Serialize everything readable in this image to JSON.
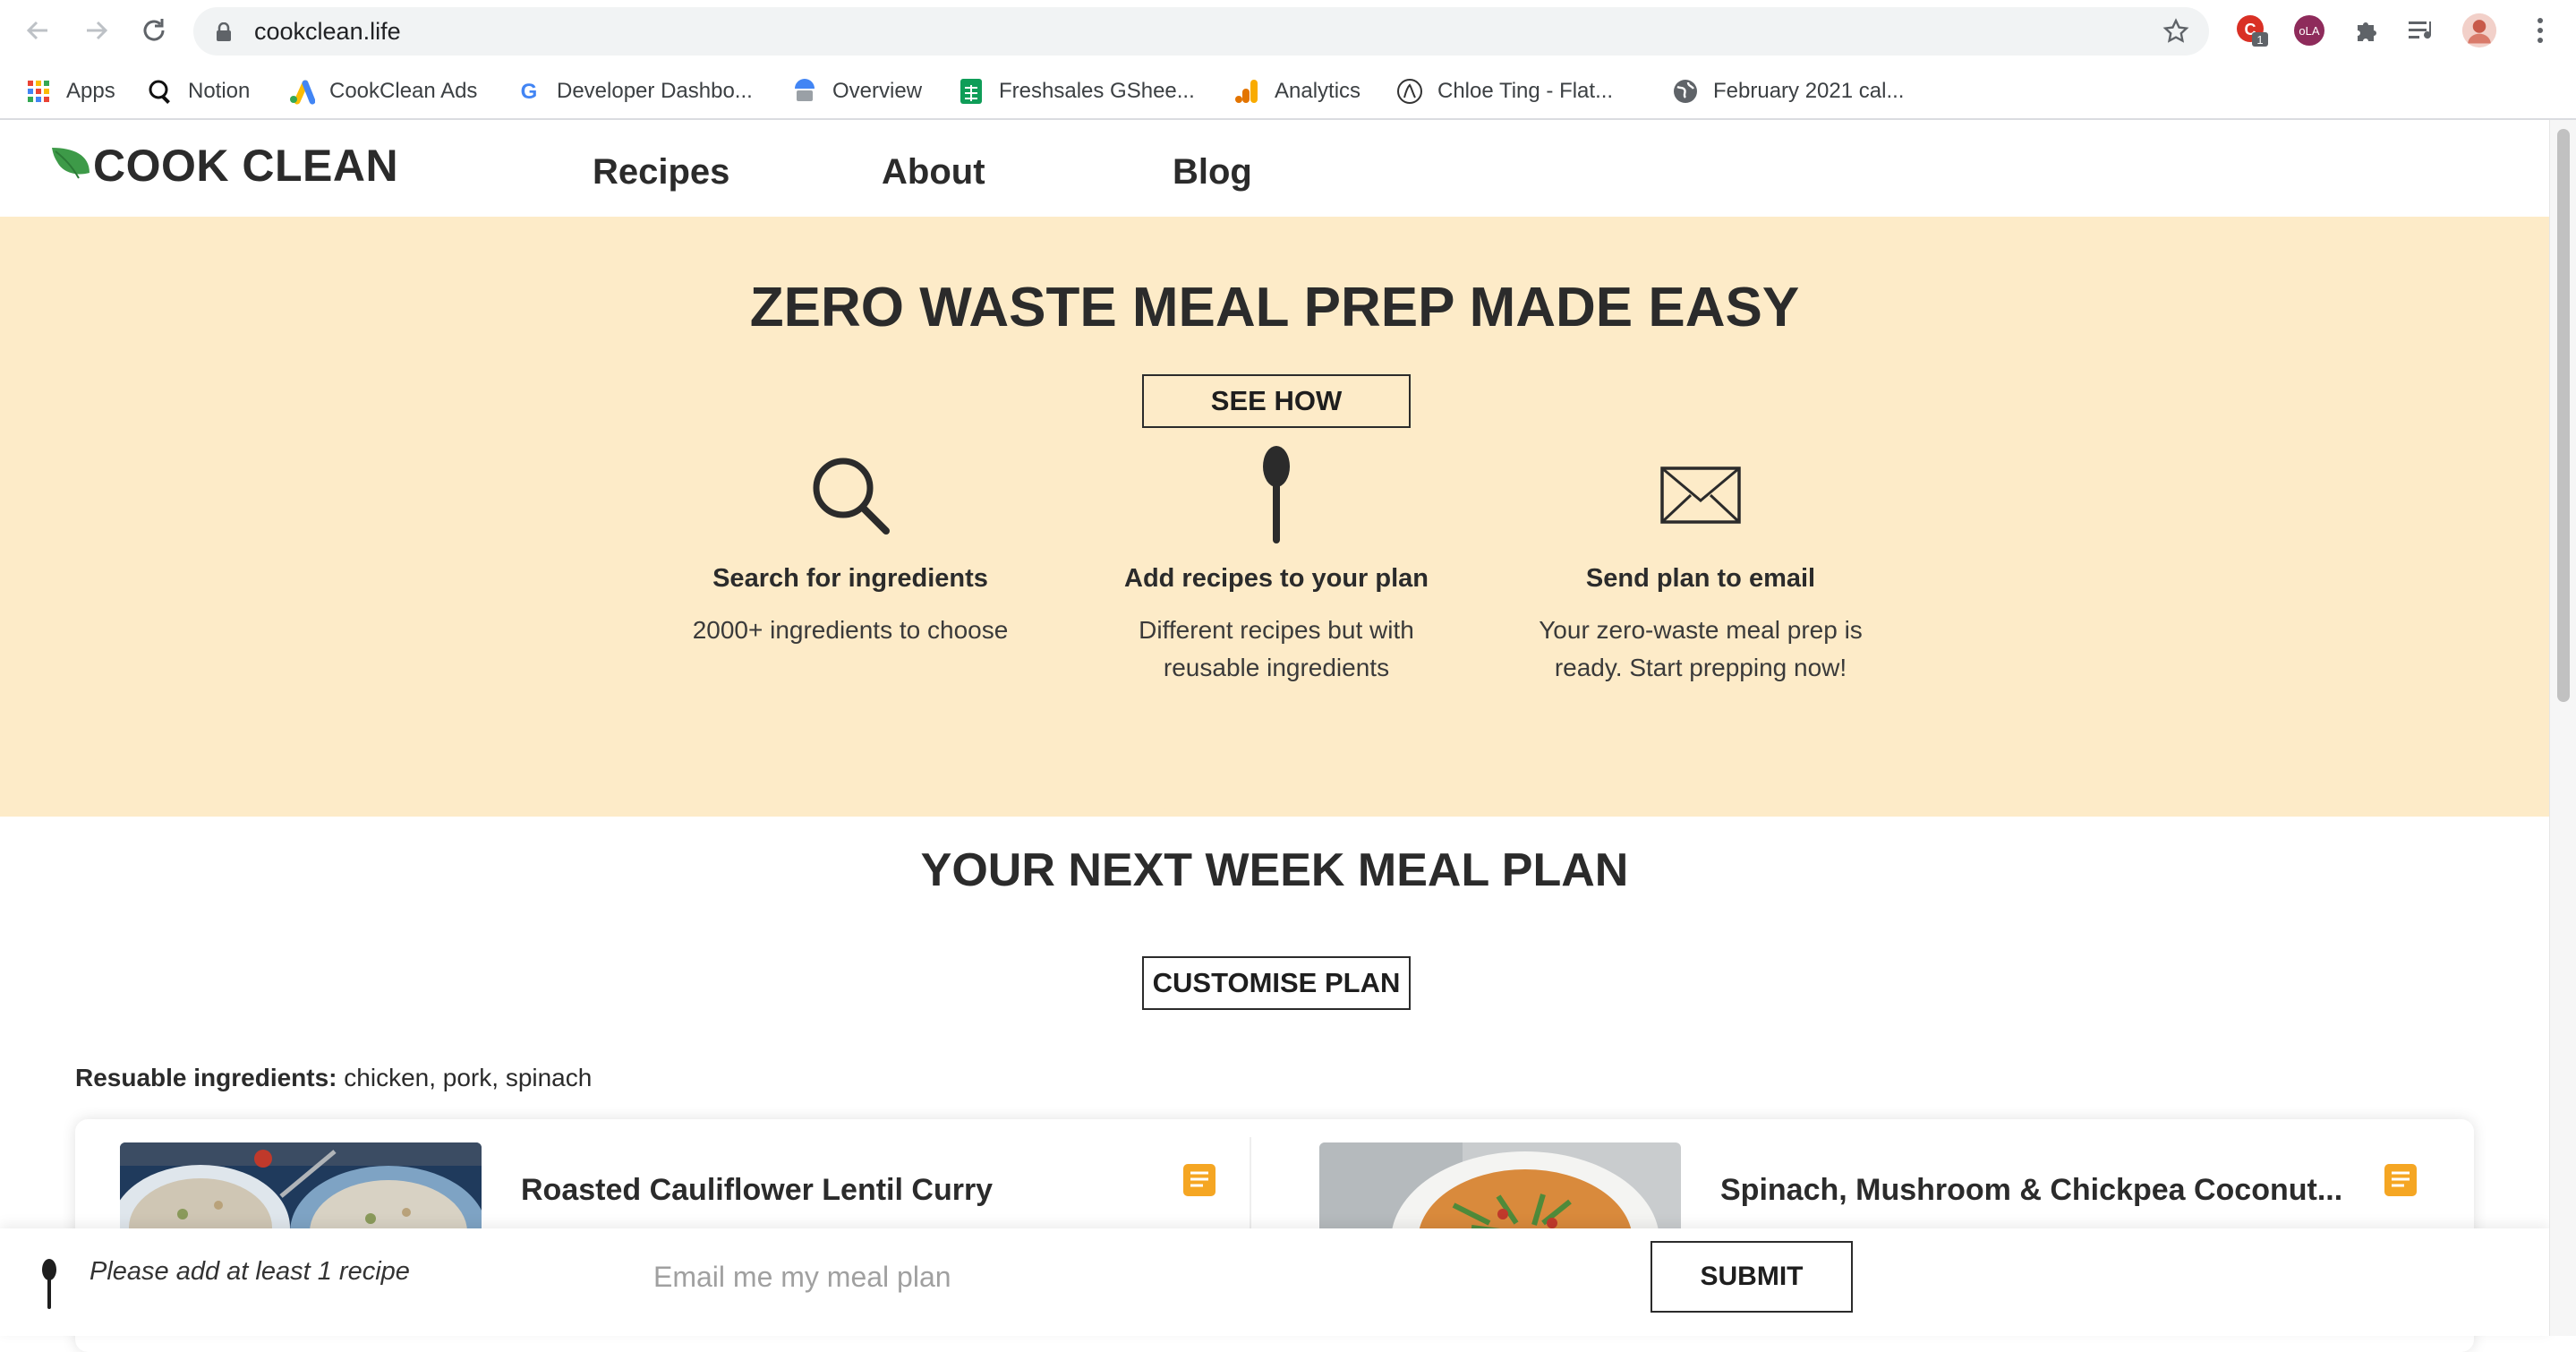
{
  "browser": {
    "url": "cookclean.life",
    "bookmarks": [
      {
        "label": "Apps",
        "icon": "apps-grid-icon"
      },
      {
        "label": "Notion",
        "icon": "notion-icon"
      },
      {
        "label": "CookClean Ads",
        "icon": "google-ads-icon"
      },
      {
        "label": "Developer Dashbo...",
        "icon": "google-icon"
      },
      {
        "label": "Overview",
        "icon": "overview-icon"
      },
      {
        "label": "Freshsales GShee...",
        "icon": "sheets-icon"
      },
      {
        "label": "Analytics",
        "icon": "analytics-icon"
      },
      {
        "label": "Chloe Ting - Flat...",
        "icon": "chloe-ting-icon"
      },
      {
        "label": "February 2021 cal...",
        "icon": "globe-icon"
      }
    ],
    "extension_badge": "1",
    "profile_badge": "oLA"
  },
  "site": {
    "logo_text": "COOK CLEAN",
    "nav": [
      "Recipes",
      "About",
      "Blog"
    ]
  },
  "hero": {
    "title": "ZERO WASTE MEAL PREP MADE EASY",
    "cta": "SEE HOW",
    "features": [
      {
        "icon": "magnifier-icon",
        "title": "Search for ingredients",
        "desc": "2000+ ingredients to choose"
      },
      {
        "icon": "spoon-icon",
        "title": "Add recipes to your plan",
        "desc_lines": [
          "Different recipes but with",
          "reusable ingredients"
        ]
      },
      {
        "icon": "envelope-icon",
        "title": "Send plan to email",
        "desc_lines": [
          "Your zero-waste meal prep is",
          "ready. Start prepping now!"
        ]
      }
    ]
  },
  "plan": {
    "title": "YOUR NEXT WEEK MEAL PLAN",
    "customise": "CUSTOMISE PLAN",
    "reusable_label": "Resuable ingredients:",
    "reusable_value": " chicken, pork, spinach",
    "recipes": [
      {
        "title": "Roasted Cauliflower Lentil Curry"
      },
      {
        "title": "Spinach, Mushroom & Chickpea Coconut..."
      }
    ]
  },
  "bottom": {
    "hint": "Please add at least 1 recipe",
    "email_placeholder": "Email me my meal plan",
    "submit": "SUBMIT"
  },
  "colors": {
    "hero_bg": "#fdebc8",
    "brand_green": "#3d9a48",
    "note_orange": "#f5a623",
    "text_dark": "#2b2b2b"
  }
}
